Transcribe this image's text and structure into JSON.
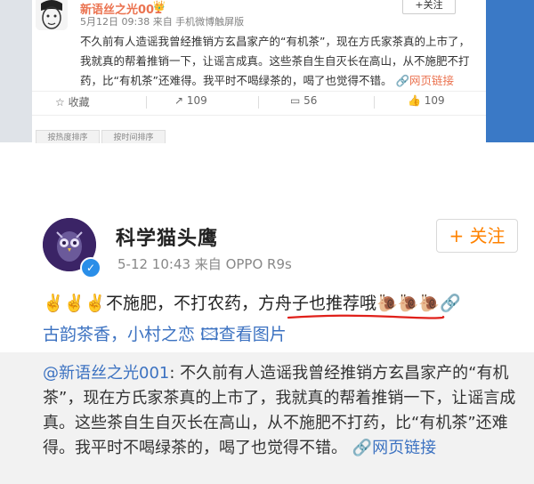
{
  "top_post": {
    "username": "新语丝之光001",
    "badge": "👑",
    "follow_label": "+关注",
    "meta": "5月12日 09:38 来自 手机微博触屏版",
    "text_main": "不久前有人造谣我曾经推销方玄昌家产的“有机茶”，现在方氏家茶真的上市了，我就真的帮着推销一下，让谣言成真。这些茶自生自灭长在高山，从不施肥不打药，比“有机茶”还难得。我平时不喝绿茶的，喝了也觉得不错。",
    "link_text": "网页链接",
    "actions": {
      "collect": "收藏",
      "repost": "109",
      "comment": "56",
      "like": "109"
    },
    "tabs": [
      "按热度排序",
      "按时间排序"
    ]
  },
  "mobile_post": {
    "username": "科学猫头鹰",
    "meta": "5-12 10:43  来自 OPPO R9s",
    "follow_label": "+ 关注",
    "line1_prefix": "不施肥，不打农药，",
    "line1_highlight": "方舟子也推荐哦",
    "line2_text": "古韵茶香，小村之恋",
    "view_image": "查看图片",
    "quote": {
      "at": "@新语丝之光001",
      "text": ": 不久前有人造谣我曾经推销方玄昌家产的“有机茶”，现在方氏家茶真的上市了，我就真的帮着推销一下，让谣言成真。这些茶自生自灭长在高山，从不施肥不打药，比“有机茶”还难得。我平时不喝绿茶的，喝了也觉得不错。",
      "link_text": "网页链接"
    }
  },
  "colors": {
    "accent_orange": "#ff8200",
    "username_orange": "#eb7350",
    "link_blue": "#3c72c1",
    "underline_red": "#e0201a"
  }
}
